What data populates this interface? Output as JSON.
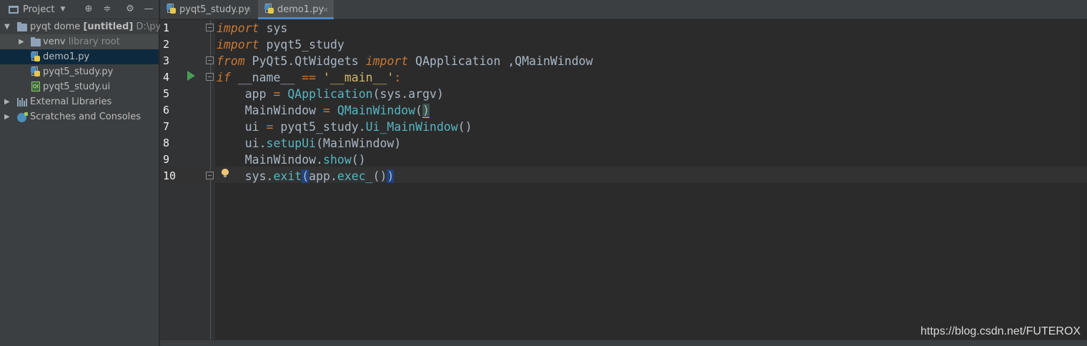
{
  "project_panel": {
    "title": "Project",
    "tree": [
      {
        "name": "pyqt dome",
        "bold": "[untitled]",
        "path": "D:\\pyqt",
        "icon": "folder-icon"
      },
      {
        "name": "venv",
        "note": "library root",
        "icon": "folder-icon"
      },
      {
        "name": "demo1.py",
        "icon": "python-file-icon",
        "selected": true
      },
      {
        "name": "pyqt5_study.py",
        "icon": "python-file-icon"
      },
      {
        "name": "pyqt5_study.ui",
        "icon": "qt-ui-file-icon"
      },
      {
        "name": "External Libraries",
        "icon": "library-icon"
      },
      {
        "name": "Scratches and Consoles",
        "icon": "scratches-icon"
      }
    ]
  },
  "tabs": [
    {
      "label": "pyqt5_study.py",
      "close": "×",
      "active": false
    },
    {
      "label": "demo1.py",
      "close": "×",
      "active": true
    }
  ],
  "editor": {
    "line_numbers": [
      "1",
      "2",
      "3",
      "4",
      "5",
      "6",
      "7",
      "8",
      "9",
      "10"
    ],
    "current_line": 10
  },
  "colors": {
    "keyword": "#cc7832",
    "function": "#56b6c2",
    "string": "#6a8759",
    "text": "#a9b7c6",
    "run_marker": "#499c54"
  },
  "watermark": "https://blog.csdn.net/FUTEROX"
}
